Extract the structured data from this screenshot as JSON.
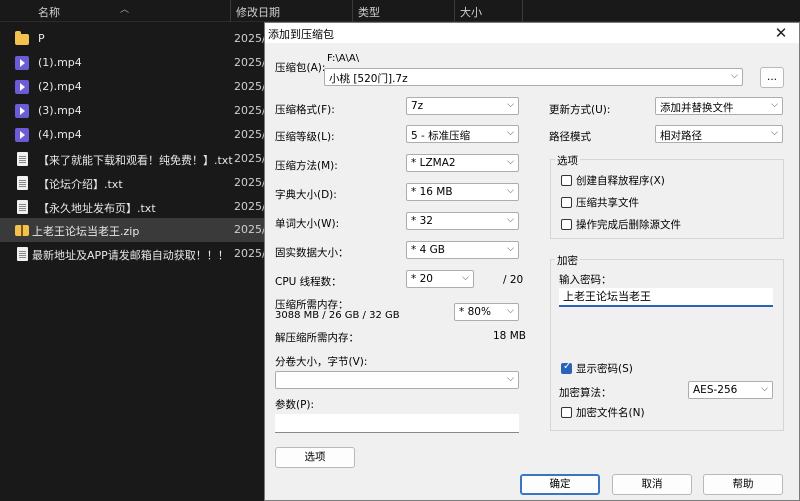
{
  "explorer": {
    "columns": {
      "name": "名称",
      "date": "修改日期",
      "type": "类型",
      "size": "大小"
    },
    "rows": [
      {
        "name": "P",
        "date": "2025/",
        "icon": "folder-icon"
      },
      {
        "name": "(1).mp4",
        "date": "2025/",
        "icon": "mp4-icon"
      },
      {
        "name": "(2).mp4",
        "date": "2025/",
        "icon": "mp4-icon"
      },
      {
        "name": "(3).mp4",
        "date": "2025/",
        "icon": "mp4-icon"
      },
      {
        "name": "(4).mp4",
        "date": "2025/",
        "icon": "mp4-icon"
      },
      {
        "name": "【来了就能下载和观看！纯免费！】.txt",
        "date": "2025/",
        "icon": "txt-icon"
      },
      {
        "name": "【论坛介绍】.txt",
        "date": "2025/",
        "icon": "txt-icon"
      },
      {
        "name": "【永久地址发布页】.txt",
        "date": "2025/",
        "icon": "txt-icon"
      },
      {
        "name": "上老王论坛当老王.zip",
        "date": "2025/",
        "icon": "zip-icon",
        "selected": true
      },
      {
        "name": "最新地址及APP请发邮箱自动获取！！！...",
        "date": "2025/",
        "icon": "txt-icon"
      }
    ]
  },
  "dialog": {
    "title": "添加到压缩包",
    "close": "✕",
    "archive_label": "压缩包(A):",
    "archive_path": "F:\\A\\A\\",
    "archive_name": "小桃 [520门].7z",
    "browse": "...",
    "format_label": "压缩格式(F):",
    "format_value": "7z",
    "level_label": "压缩等级(L):",
    "level_value": "5 - 标准压缩",
    "method_label": "压缩方法(M):",
    "method_value": "*  LZMA2",
    "dict_label": "字典大小(D):",
    "dict_value": "*  16 MB",
    "word_label": "单词大小(W):",
    "word_value": "*  32",
    "solid_label": "固实数据大小：",
    "solid_value": "*  4 GB",
    "cpu_label": "CPU 线程数：",
    "cpu_value": "*  20",
    "cpu_total": "/ 20",
    "mem_label": "压缩所需内存：",
    "mem_detail": "3088 MB / 26 GB / 32 GB",
    "mem_value": "* 80%",
    "unmem_label": "解压缩所需内存：",
    "unmem_value": "18 MB",
    "split_label": "分卷大小，字节(V):",
    "split_value": "",
    "params_label": "参数(P):",
    "options_button": "选项",
    "update_label": "更新方式(U):",
    "update_value": "添加并替换文件",
    "path_label": "路径模式",
    "path_value": "相对路径",
    "options_group": "选项",
    "opt_sfx": "创建自释放程序(X)",
    "opt_shared": "压缩共享文件",
    "opt_delete": "操作完成后删除源文件",
    "encrypt_group": "加密",
    "pwd_label": "输入密码：",
    "pwd_value": "上老王论坛当老王",
    "show_pwd": "显示密码(S)",
    "enc_method_label": "加密算法：",
    "enc_method_value": "AES-256",
    "enc_names": "加密文件名(N)",
    "ok": "确定",
    "cancel": "取消",
    "help": "帮助"
  }
}
